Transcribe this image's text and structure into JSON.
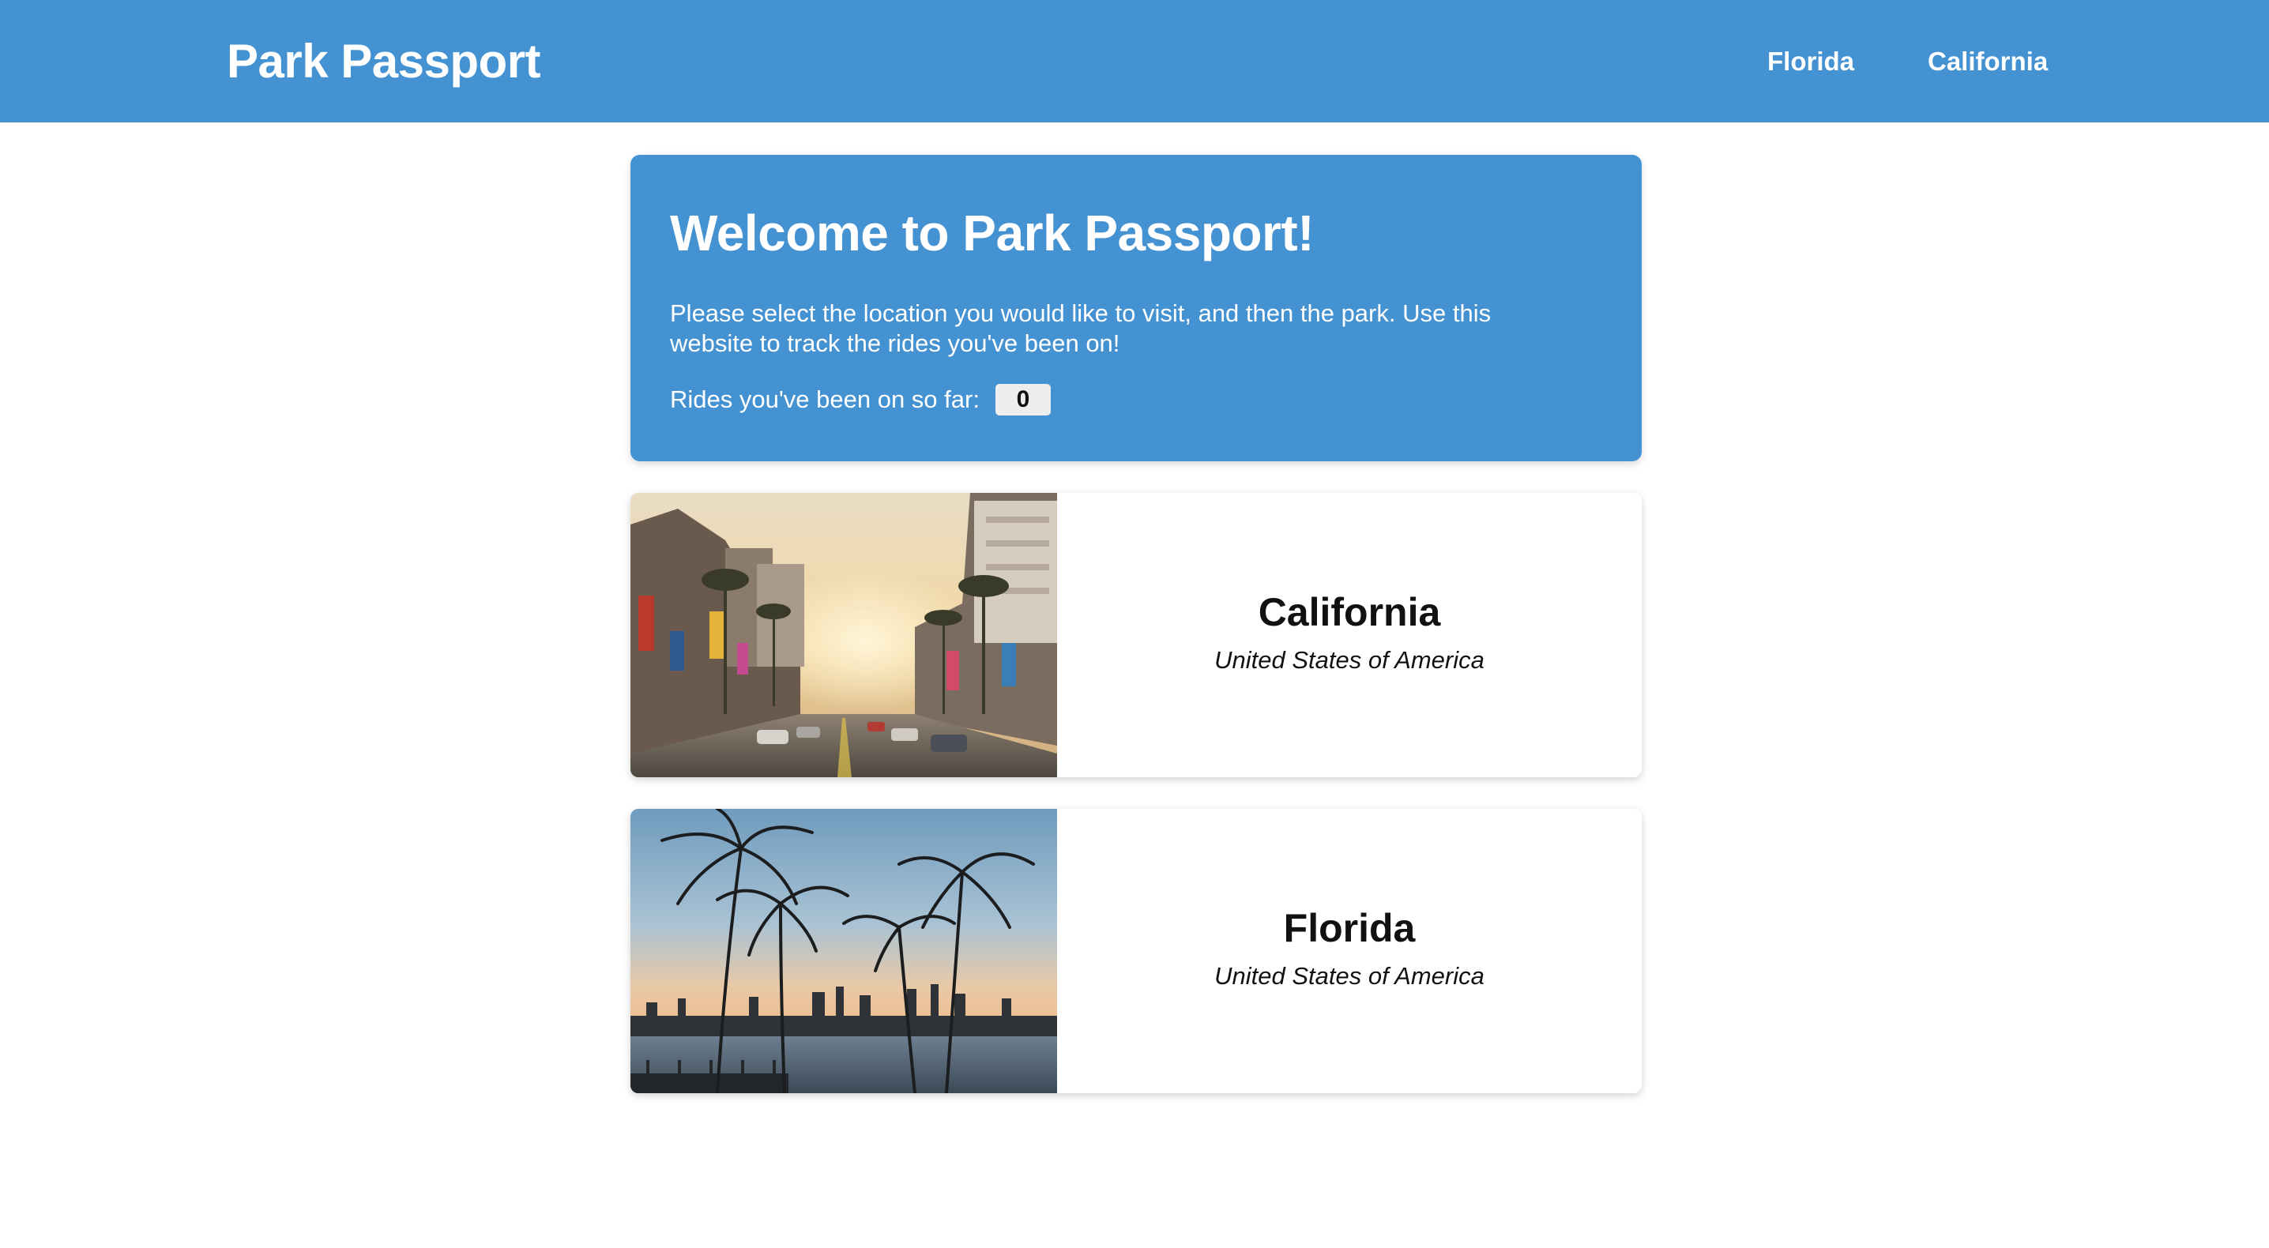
{
  "header": {
    "brand": "Park Passport",
    "nav": [
      "Florida",
      "California"
    ]
  },
  "welcome": {
    "title": "Welcome to Park Passport!",
    "text": "Please select the location you would like to visit, and then the park. Use this website to track the rides you've been on!",
    "rides_label": "Rides you've been on so far:",
    "rides_count": "0"
  },
  "locations": [
    {
      "name": "California",
      "country": "United States of America",
      "image": "hollywood-boulevard-sunset-photo"
    },
    {
      "name": "Florida",
      "country": "United States of America",
      "image": "palm-trees-city-skyline-photo"
    }
  ],
  "colors": {
    "primary": "#4492d2",
    "background": "#ffffff",
    "badge": "#eeeeee"
  }
}
